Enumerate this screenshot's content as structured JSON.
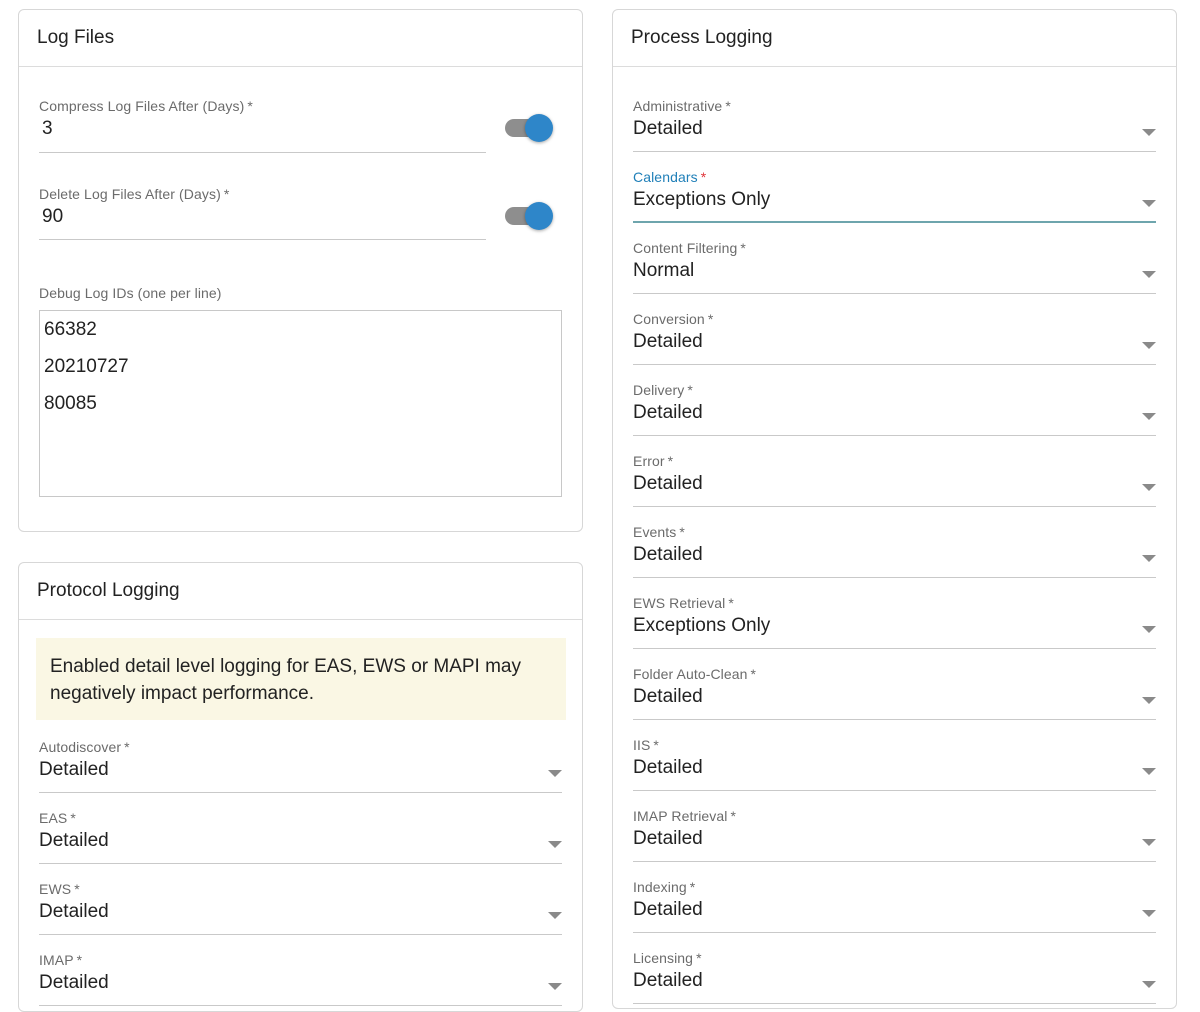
{
  "log_files": {
    "title": "Log Files",
    "compress": {
      "label": "Compress Log Files After (Days)",
      "value": "3",
      "enabled": true
    },
    "delete": {
      "label": "Delete Log Files After (Days)",
      "value": "90",
      "enabled": true
    },
    "debug_ids": {
      "label": "Debug Log IDs (one per line)",
      "lines": [
        "66382",
        "20210727",
        "80085"
      ]
    }
  },
  "protocol_logging": {
    "title": "Protocol Logging",
    "warning": "Enabled detail level logging for EAS, EWS or MAPI may negatively impact performance.",
    "fields": [
      {
        "label": "Autodiscover",
        "value": "Detailed"
      },
      {
        "label": "EAS",
        "value": "Detailed"
      },
      {
        "label": "EWS",
        "value": "Detailed"
      },
      {
        "label": "IMAP",
        "value": "Detailed"
      }
    ]
  },
  "process_logging": {
    "title": "Process Logging",
    "fields": [
      {
        "label": "Administrative",
        "value": "Detailed"
      },
      {
        "label": "Calendars",
        "value": "Exceptions Only",
        "focused": true
      },
      {
        "label": "Content Filtering",
        "value": "Normal"
      },
      {
        "label": "Conversion",
        "value": "Detailed"
      },
      {
        "label": "Delivery",
        "value": "Detailed"
      },
      {
        "label": "Error",
        "value": "Detailed"
      },
      {
        "label": "Events",
        "value": "Detailed"
      },
      {
        "label": "EWS Retrieval",
        "value": "Exceptions Only"
      },
      {
        "label": "Folder Auto-Clean",
        "value": "Detailed"
      },
      {
        "label": "IIS",
        "value": "Detailed"
      },
      {
        "label": "IMAP Retrieval",
        "value": "Detailed"
      },
      {
        "label": "Indexing",
        "value": "Detailed"
      },
      {
        "label": "Licensing",
        "value": "Detailed"
      }
    ]
  },
  "required_marker": "*",
  "colors": {
    "toggle_on": "#2e86c9",
    "focus_label": "#1f7fb8",
    "focus_underline": "#6ea5ad",
    "required_focus": "#e0353a",
    "warning_bg": "#faf7e4"
  }
}
